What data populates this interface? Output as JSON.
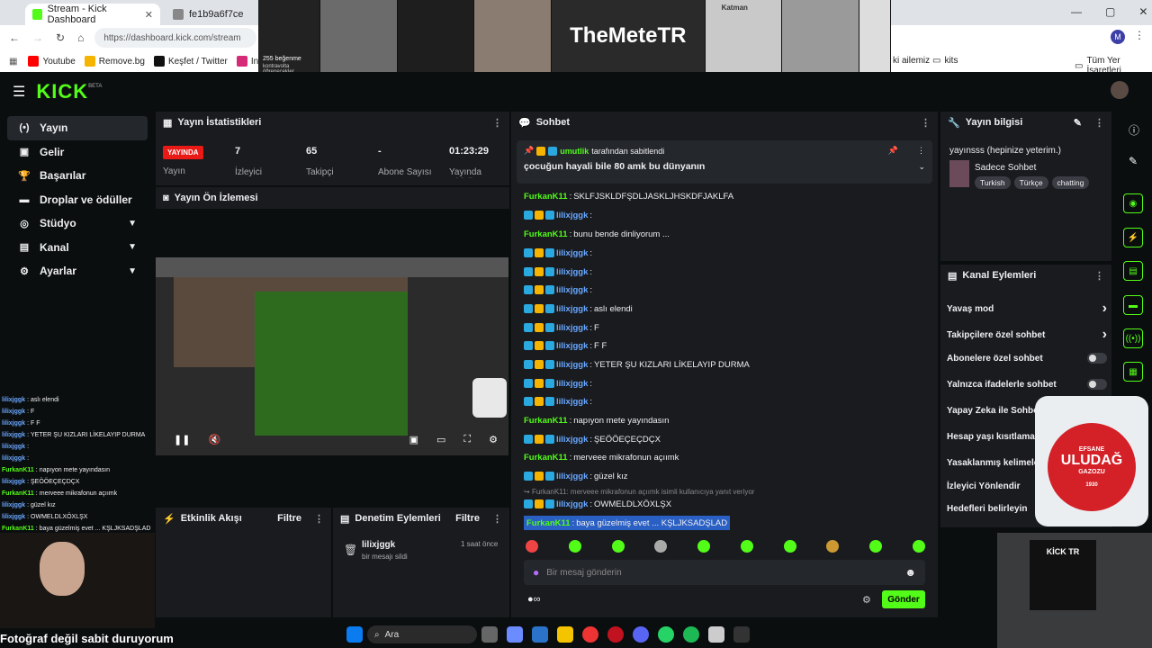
{
  "browser": {
    "tabs": [
      {
        "title": "Stream - Kick Dashboard"
      },
      {
        "title": "fe1b9a6f7ce"
      }
    ],
    "url": "https://dashboard.kick.com/stream",
    "bookmarks": [
      "Youtube",
      "Remove.bg",
      "Keşfet / Twitter",
      "Instagram",
      "ki ailemiz",
      "kits"
    ],
    "all_bookmarks": "Tüm Yer İşaretleri",
    "profile_initial": "M"
  },
  "overlay": {
    "brand": "TheMeteTR",
    "katman": "Katman",
    "insta_text": "255 beğenme",
    "insta_sub": "kontravolta öğrenecekler"
  },
  "kick": {
    "logo": "KICK",
    "beta": "BETA"
  },
  "sidebar": {
    "items": [
      {
        "label": "Yayın",
        "icon": "(•)"
      },
      {
        "label": "Gelir",
        "icon": "▣"
      },
      {
        "label": "Başarılar",
        "icon": "🏆"
      },
      {
        "label": "Droplar ve ödüller",
        "icon": "▬"
      },
      {
        "label": "Stüdyo",
        "icon": "◎"
      },
      {
        "label": "Kanal",
        "icon": "▤"
      },
      {
        "label": "Ayarlar",
        "icon": "⚙"
      }
    ]
  },
  "stats": {
    "title": "Yayın İstatistikleri",
    "live_badge": "YAYINDA",
    "live_label": "Yayın",
    "viewers": "7",
    "viewers_label": "İzleyici",
    "followers": "65",
    "followers_label": "Takipçi",
    "subs": "-",
    "subs_label": "Abone Sayısı",
    "uptime": "01:23:29",
    "uptime_label": "Yayında Olduğu Süre"
  },
  "preview": {
    "title": "Yayın Ön İzlemesi"
  },
  "activity": {
    "title": "Etkinlik Akışı",
    "filter": "Filtre"
  },
  "moderation": {
    "title": "Denetim Eylemleri",
    "filter": "Filtre",
    "user": "lilixjggk",
    "action": "bir mesajı sildi",
    "time": "1 saat önce"
  },
  "chat": {
    "title": "Sohbet",
    "pinned_by_user": "umutlik",
    "pinned_by_text": "tarafından sabitlendi",
    "pinned_message": "çocuğun hayali bile 80 amk bu dünyanın",
    "reply_ref": "FurkanK11: merveee mikrafonun açıımk isimli kullanıcıya yanıt veriyor",
    "messages": [
      {
        "user": "FurkanK11",
        "text": "SKLFJSKLDFŞDLJASKLJHSKDFJAKLFA",
        "type": "g"
      },
      {
        "user": "lilixjggk",
        "text": "",
        "type": "b"
      },
      {
        "user": "FurkanK11",
        "text": "bunu bende dinliyorum ...",
        "type": "g"
      },
      {
        "user": "lilixjggk",
        "text": "",
        "type": "b"
      },
      {
        "user": "lilixjggk",
        "text": "",
        "type": "b"
      },
      {
        "user": "lilixjggk",
        "text": "",
        "type": "b"
      },
      {
        "user": "lilixjggk",
        "text": "aslı elendi",
        "type": "b"
      },
      {
        "user": "lilixjggk",
        "text": "F",
        "type": "b"
      },
      {
        "user": "lilixjggk",
        "text": "F F",
        "type": "b"
      },
      {
        "user": "lilixjggk",
        "text": "YETER ŞU KIZLARI LİKELAYIP DURMA",
        "type": "b"
      },
      {
        "user": "lilixjggk",
        "text": "",
        "type": "b"
      },
      {
        "user": "lilixjggk",
        "text": "",
        "type": "b"
      },
      {
        "user": "FurkanK11",
        "text": "napıyon mete yayındasın",
        "type": "g"
      },
      {
        "user": "lilixjggk",
        "text": "ŞEÖÖEÇEÇDÇX",
        "type": "b"
      },
      {
        "user": "FurkanK11",
        "text": "merveee mikrafonun açıımk",
        "type": "g"
      },
      {
        "user": "lilixjggk",
        "text": "güzel kız",
        "type": "b"
      },
      {
        "user": "lilixjggk",
        "text": "OWMELDLXÖXLŞX",
        "type": "b"
      },
      {
        "user": "FurkanK11",
        "text": "baya güzelmiş evet ... KŞLJKSADŞLAD",
        "type": "g"
      }
    ],
    "input_placeholder": "Bir mesaj gönderin",
    "send": "Gönder"
  },
  "stream_info": {
    "title": "Yayın bilgisi",
    "stream_title": "yayınsss (hepinize yeterim.)",
    "category": "Sadece Sohbet",
    "tags": [
      "Turkish",
      "Türkçe",
      "chatting"
    ]
  },
  "channel_actions": {
    "title": "Kanal Eylemleri",
    "items": [
      "Yavaş mod",
      "Takipçilere özel sohbet",
      "Abonelere özel sohbet",
      "Yalnızca ifadelerle sohbet",
      "Yapay Zeka ile Sohbet",
      "Hesap yaşı kısıtlaması",
      "Yasaklanmış kelimeler",
      "İzleyici Yönlendir",
      "Hedefleri belirleyin"
    ]
  },
  "obs_chat": [
    {
      "user": "lilixjggk",
      "text": "aslı elendi"
    },
    {
      "user": "lilixjggk",
      "text": "F"
    },
    {
      "user": "lilixjggk",
      "text": "F F"
    },
    {
      "user": "lilixjggk",
      "text": "YETER ŞU KIZLARI LİKELAYIP DURMA"
    },
    {
      "user": "lilixjggk",
      "text": ""
    },
    {
      "user": "lilixjggk",
      "text": ""
    },
    {
      "user": "FurkanK11",
      "text": "napıyon mete yayındasın"
    },
    {
      "user": "lilixjggk",
      "text": "ŞEÖÖEÇEÇDÇX"
    },
    {
      "user": "FurkanK11",
      "text": "merveee mikrafonun açıımk"
    },
    {
      "user": "lilixjggk",
      "text": "güzel kız"
    },
    {
      "user": "lilixjggk",
      "text": "OWMELDLXÖXLŞX"
    },
    {
      "user": "FurkanK11",
      "text": "baya güzelmiş evet ... KŞLJKSADŞLAD"
    }
  ],
  "caption": "Fotoğraf değil sabit duruyorum",
  "bottle": {
    "brand": "ULUDAĞ",
    "top": "EFSANE",
    "sub": "GAZOZU",
    "year": "1930"
  },
  "kick_tr_sign": "KİCK TR",
  "taskbar": {
    "search": "Ara"
  },
  "colors": {
    "kick_green": "#53fc18",
    "live_red": "#e91916",
    "panel": "#191b1f"
  }
}
